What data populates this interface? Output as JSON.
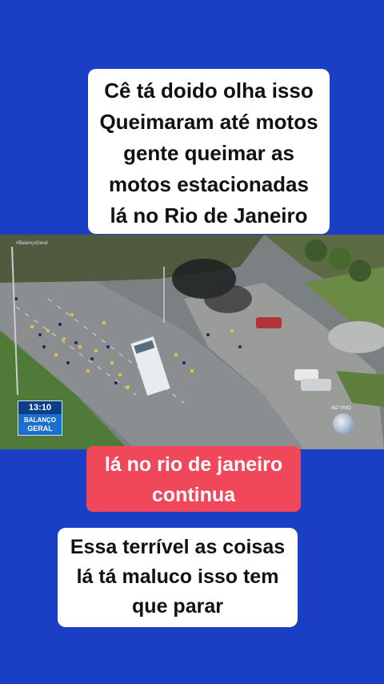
{
  "captions": {
    "top": [
      "Cê tá doido olha isso",
      "Queimaram até motos",
      "gente queimar as",
      "motos estacionadas",
      "lá no Rio de Janeiro"
    ],
    "middle": [
      "lá no rio de janeiro",
      "continua"
    ],
    "bottom": [
      "Essa terrível as coisas",
      "lá tá maluco isso tem",
      "que parar"
    ]
  },
  "video": {
    "watermark": "#BalançoGeral",
    "time": "13:10",
    "show_name_line1": "BALANÇO",
    "show_name_line2": "GERAL",
    "live_label": "AO VIVO",
    "channel_logo": "record-tv-logo"
  },
  "colors": {
    "background": "#1a3fc4",
    "caption_bg": "#ffffff",
    "highlight_bg": "#f0475b"
  }
}
